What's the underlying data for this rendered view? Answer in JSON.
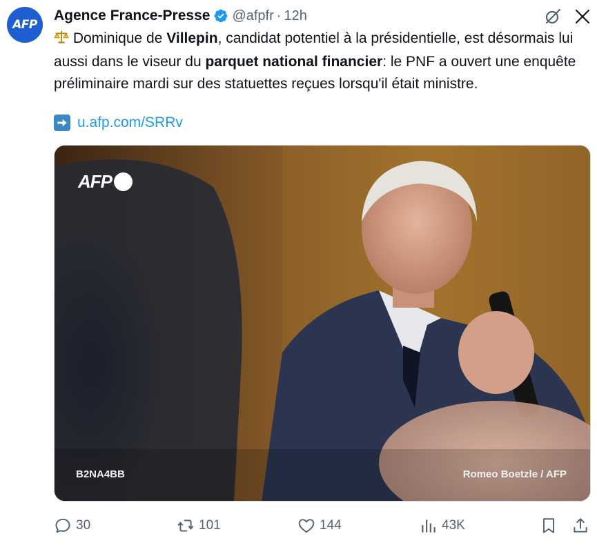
{
  "author": {
    "avatar_text": "AFP",
    "name": "Agence France-Presse",
    "handle": "@afpfr",
    "separator": "·",
    "time": "12h"
  },
  "tweet": {
    "emoji": "⚖️",
    "p1": " Dominique de ",
    "b1": "Villepin",
    "p2": ", candidat potentiel à la présidentielle, est désormais lui aussi dans le viseur du ",
    "b2": "parquet national financier",
    "p3": ": le PNF a ouvert une enquête préliminaire mardi sur des statuettes reçues lorsqu'il était ministre.",
    "link_emoji": "➡️",
    "link": "u.afp.com/SRRv"
  },
  "media": {
    "logo_text": "AFP",
    "code": "B2NA4BB",
    "credit": "Romeo Boetzle / AFP"
  },
  "actions": {
    "replies": "30",
    "reposts": "101",
    "likes": "144",
    "views": "43K"
  },
  "colors": {
    "avatar_bg": "#1d5fd1",
    "link": "#1d9bf0",
    "muted": "#536471",
    "verified": "#1d9bf0"
  }
}
